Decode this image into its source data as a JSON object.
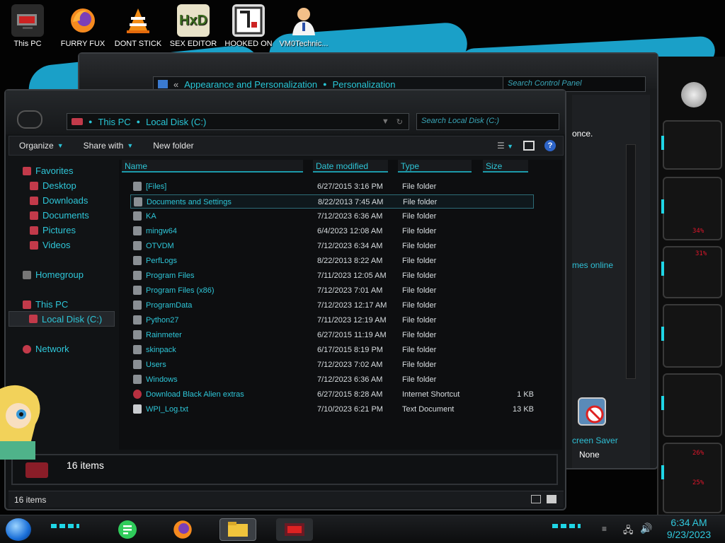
{
  "desktop": {
    "icons": [
      {
        "label": "This PC",
        "icon": "computer-icon"
      },
      {
        "label": "FURRY FUX",
        "icon": "firefox-icon"
      },
      {
        "label": "DONT STICK",
        "icon": "vlc-cone-icon"
      },
      {
        "label": "SEX EDITOR",
        "icon": "hxd-icon"
      },
      {
        "label": "HOOKED ON",
        "icon": "app-icon"
      },
      {
        "label": "VM0Technic...",
        "icon": "person-icon"
      }
    ]
  },
  "control_panel": {
    "breadcrumb": [
      "Appearance and Personalization",
      "Personalization"
    ],
    "search_placeholder": "Search Control Panel",
    "fragment_once": "once.",
    "fragment_themes": "mes online",
    "screensaver_label": "creen Saver",
    "screensaver_value": "None"
  },
  "explorer": {
    "breadcrumb": [
      "This PC",
      "Local Disk (C:)"
    ],
    "search_placeholder": "Search Local Disk (C:)",
    "toolbar": {
      "organize": "Organize",
      "share_with": "Share with",
      "new_folder": "New folder"
    },
    "sidebar": {
      "favorites": "Favorites",
      "desktop": "Desktop",
      "downloads": "Downloads",
      "documents": "Documents",
      "pictures": "Pictures",
      "videos": "Videos",
      "homegroup": "Homegroup",
      "this_pc": "This PC",
      "local_disk": "Local Disk (C:)",
      "network": "Network"
    },
    "columns": {
      "name": "Name",
      "date": "Date modified",
      "type": "Type",
      "size": "Size"
    },
    "files": [
      {
        "name": "[Files]",
        "date": "6/27/2015 3:16 PM",
        "type": "File folder",
        "size": ""
      },
      {
        "name": "Documents and Settings",
        "date": "8/22/2013 7:45 AM",
        "type": "File folder",
        "size": ""
      },
      {
        "name": "KA",
        "date": "7/12/2023 6:36 AM",
        "type": "File folder",
        "size": ""
      },
      {
        "name": "mingw64",
        "date": "6/4/2023 12:08 AM",
        "type": "File folder",
        "size": ""
      },
      {
        "name": "OTVDM",
        "date": "7/12/2023 6:34 AM",
        "type": "File folder",
        "size": ""
      },
      {
        "name": "PerfLogs",
        "date": "8/22/2013 8:22 AM",
        "type": "File folder",
        "size": ""
      },
      {
        "name": "Program Files",
        "date": "7/11/2023 12:05 AM",
        "type": "File folder",
        "size": ""
      },
      {
        "name": "Program Files (x86)",
        "date": "7/12/2023 7:01 AM",
        "type": "File folder",
        "size": ""
      },
      {
        "name": "ProgramData",
        "date": "7/12/2023 12:17 AM",
        "type": "File folder",
        "size": ""
      },
      {
        "name": "Python27",
        "date": "7/11/2023 12:19 AM",
        "type": "File folder",
        "size": ""
      },
      {
        "name": "Rainmeter",
        "date": "6/27/2015 11:19 AM",
        "type": "File folder",
        "size": ""
      },
      {
        "name": "skinpack",
        "date": "6/17/2015 8:19 PM",
        "type": "File folder",
        "size": ""
      },
      {
        "name": "Users",
        "date": "7/12/2023 7:02 AM",
        "type": "File folder",
        "size": ""
      },
      {
        "name": "Windows",
        "date": "7/12/2023 6:36 AM",
        "type": "File folder",
        "size": ""
      },
      {
        "name": "Download Black Alien extras",
        "date": "6/27/2015 8:28 AM",
        "type": "Internet Shortcut",
        "size": "1 KB"
      },
      {
        "name": "WPI_Log.txt",
        "date": "7/10/2023 6:21 PM",
        "type": "Text Document",
        "size": "13 KB"
      }
    ],
    "details_count": "16 items",
    "status_count": "16 items"
  },
  "gadgets": {
    "percent_a": "34%",
    "percent_b": "31%",
    "percent_c": "26%",
    "percent_d": "25%"
  },
  "taskbar": {
    "time": "6:34 AM",
    "date": "9/23/2023"
  },
  "colors": {
    "accent_cyan": "#2ec6d8",
    "alien_red": "#e0162b"
  }
}
